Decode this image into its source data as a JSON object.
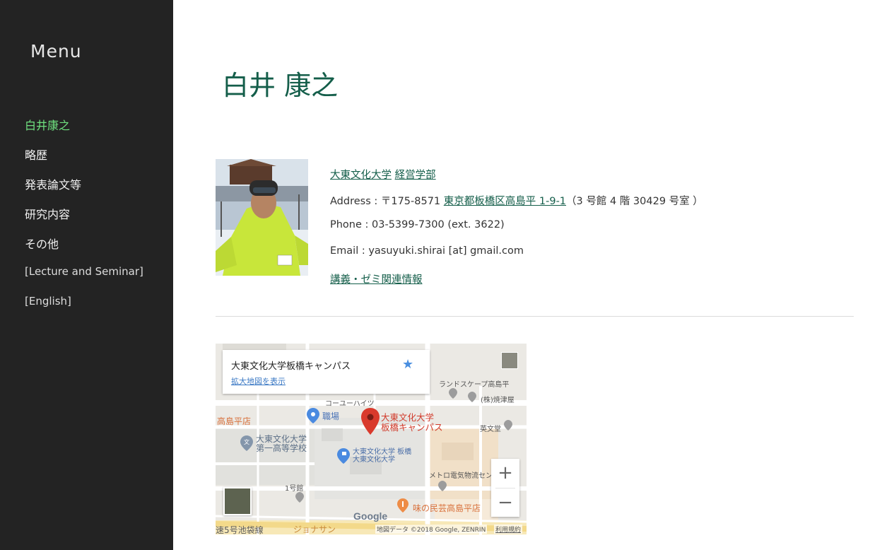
{
  "sidebar": {
    "title": "Menu",
    "items": [
      {
        "label": "白井康之",
        "active": true
      },
      {
        "label": "略歴"
      },
      {
        "label": "発表論文等"
      },
      {
        "label": "研究内容"
      },
      {
        "label": "その他"
      },
      {
        "label": "[Lecture and Seminar]"
      },
      {
        "label": "[English]"
      }
    ]
  },
  "main": {
    "title": "白井 康之",
    "affiliation": {
      "university": "大東文化大学",
      "faculty": "経営学部"
    },
    "address": {
      "prefix": "Address : 〒175-8571 ",
      "link": "東京都板橋区高島平 1-9-1",
      "suffix": "（3 号館 4 階 30429 号室 ）"
    },
    "phone": "Phone : 03-5399-7300 (ext. 3622)",
    "email": "Email : yasuyuki.shirai [at] gmail.com",
    "lecture_link": "講義・ゼミ関連情報"
  },
  "map": {
    "place_name": "大東文化大学板橋キャンパス",
    "enlarge_link": "拡大地図を表示",
    "labels": {
      "campus_line1": "大東文化大学",
      "campus_line2": "板橋キャンパス",
      "office": "職場",
      "coho": "コーユーハイツ",
      "landscape": "ランドスケープ高島平",
      "yaizu": "(株)焼津屋",
      "eikodo": "英文堂",
      "takashimadaira_store": "高島平店",
      "school_line1": "大東文化大学",
      "school_line2": "第一高等学校",
      "univ_itabashi_line1": "大東文化大学 板橋",
      "univ_itabashi_line2": "大東文化大学",
      "metro": "メトロ電気物流セン",
      "building1": "1号館",
      "restaurant": "味の民芸高島平店",
      "route5": "速5号池袋線",
      "jonathan": "ジョナサン"
    },
    "google_logo": "Google",
    "credit": "地図データ ©2018 Google, ZENRIN",
    "terms": "利用規約",
    "zoom_in": "+",
    "zoom_out": "−"
  },
  "colors": {
    "sidebar_bg": "#232323",
    "accent_green": "#145e4a",
    "active_nav": "#6fe07f",
    "map_pin": "#d93a2c"
  }
}
